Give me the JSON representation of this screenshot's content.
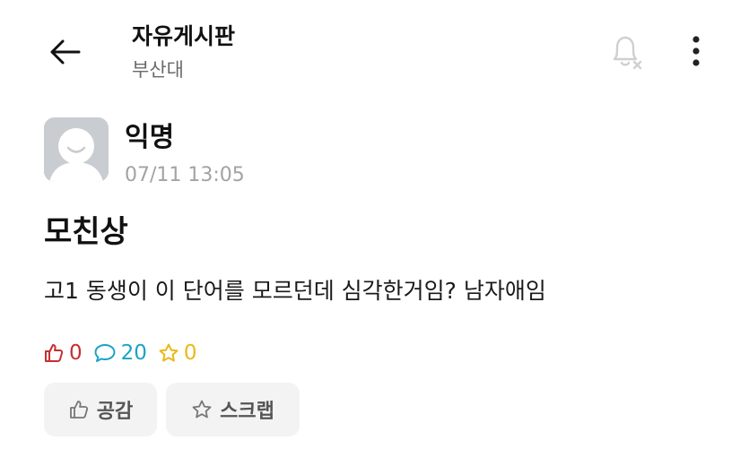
{
  "header": {
    "title": "자유게시판",
    "subtitle": "부산대",
    "icons": {
      "back": "arrow-left-icon",
      "notification": "bell-off-icon",
      "more": "more-vertical-icon"
    }
  },
  "post": {
    "author": "익명",
    "time": "07/11 13:05",
    "title": "모친상",
    "body": "고1 동생이 이 단어를 모르던데 심각한거임? 남자애임"
  },
  "stats": {
    "likes": "0",
    "comments": "20",
    "scraps": "0"
  },
  "actions": {
    "like_label": "공감",
    "scrap_label": "스크랩"
  },
  "colors": {
    "like": "#c62f2f",
    "comment": "#1ba4c4",
    "scrap": "#e8b91a",
    "button_bg": "#f3f3f3",
    "avatar_bg": "#c9ccd0"
  }
}
